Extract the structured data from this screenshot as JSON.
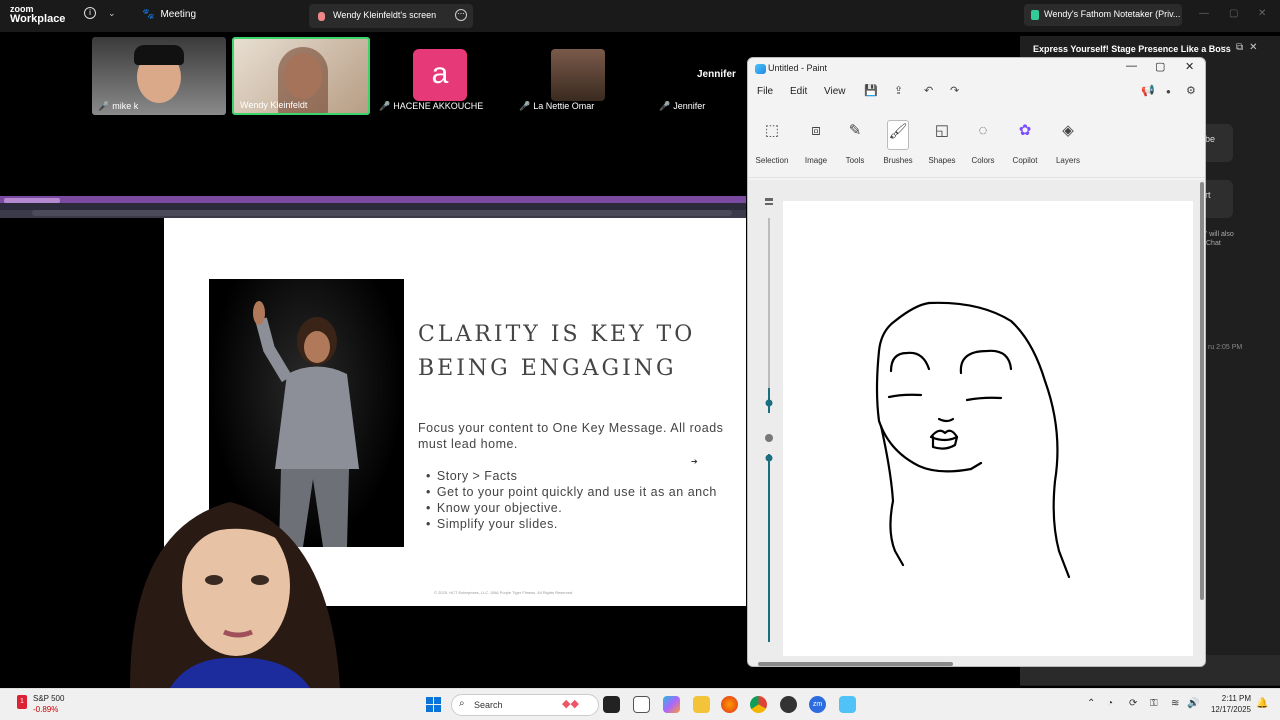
{
  "zoom_bar": {
    "logo_top": "zoom",
    "logo_bottom": "Workplace",
    "meeting_label": "Meeting",
    "share_label": "Wendy Kleinfeldt's screen",
    "fathom_label": "Wendy's Fathom Notetaker (Priv..."
  },
  "participants": [
    {
      "name": "mike k"
    },
    {
      "name": "Wendy Kleinfeldt"
    },
    {
      "name": "HACENE AKKOUCHE",
      "initial": "a"
    },
    {
      "name": "La Nettie Omar"
    },
    {
      "name": "Jennifer",
      "big_name": "Jennifer"
    }
  ],
  "side_panel": {
    "title": "Express Yourself! Stage Presence Like a Boss",
    "btn1": "be",
    "btn2": "rt",
    "note_line1": "' will also",
    "note_line2": "Chat",
    "time": "ru 2:05 PM"
  },
  "slide": {
    "title_line1": "CLARITY IS KEY TO",
    "title_line2": "BEING ENGAGING",
    "body_line1": "Focus your content to One Key Message. All roads",
    "body_line2": "must lead home.",
    "bullets": [
      "Story > Facts",
      "Get to your point quickly and use it as an anch",
      "Know your objective.",
      "Simplify your slides."
    ],
    "footer": "© 2025. HCT Enterprises, LLC. DBA Purple Tiger Fitness. All Rights Reserved."
  },
  "paint": {
    "title": "Untitled - Paint",
    "menu": [
      "File",
      "Edit",
      "View"
    ],
    "tools": [
      {
        "label": "Selection",
        "icon": "selection-icon"
      },
      {
        "label": "Image",
        "icon": "image-icon"
      },
      {
        "label": "Tools",
        "icon": "tools-icon"
      },
      {
        "label": "Brushes",
        "icon": "brushes-icon"
      },
      {
        "label": "Shapes",
        "icon": "shapes-icon"
      },
      {
        "label": "Colors",
        "icon": "colors-icon"
      },
      {
        "label": "Copilot",
        "icon": "copilot-icon"
      },
      {
        "label": "Layers",
        "icon": "layers-icon"
      }
    ]
  },
  "taskbar": {
    "stock_name": "S&P 500",
    "stock_change": "-0.89%",
    "stock_badge": "1",
    "search_placeholder": "Search",
    "time": "2:11 PM",
    "date": "12/17/2025"
  },
  "colors": {
    "accent_green": "#3bd56b",
    "avatar_pink": "#e63a78",
    "windows_blue": "#0a74d8"
  }
}
